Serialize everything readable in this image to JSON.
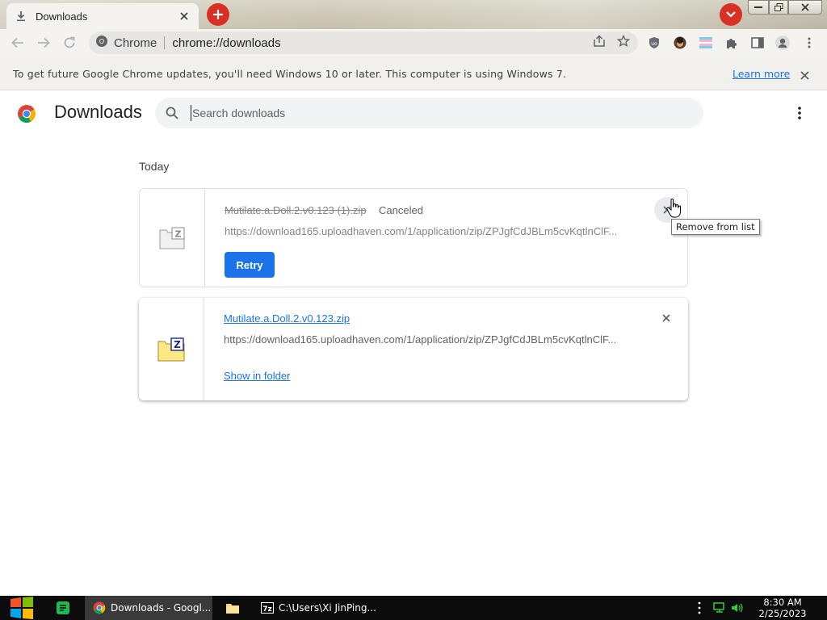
{
  "browser": {
    "tab": {
      "title": "Downloads",
      "icon": "download-icon"
    },
    "colors": {
      "accent_red": "#d93025",
      "link_blue": "#1a73e8"
    },
    "omnibox": {
      "site_label": "Chrome",
      "url": "chrome://downloads"
    }
  },
  "infobar": {
    "message": "To get future Google Chrome updates, you'll need Windows 10 or later. This computer is using Windows 7.",
    "link": "Learn more"
  },
  "page": {
    "title": "Downloads",
    "search_placeholder": "Search downloads",
    "section": "Today"
  },
  "downloads": [
    {
      "filename": "Mutilate.a.Doll.2.v0.123 (1).zip",
      "status": "Canceled",
      "url": "https://download165.uploadhaven.com/1/application/zip/ZPJgfCdJBLm5cvKqtlnClF...",
      "action": "Retry",
      "icon": "zip-file-icon-faded"
    },
    {
      "filename": "Mutilate.a.Doll.2.v0.123.zip",
      "status": "",
      "url": "https://download165.uploadhaven.com/1/application/zip/ZPJgfCdJBLm5cvKqtlnClF...",
      "action": "Show in folder",
      "icon": "zip-file-icon"
    }
  ],
  "tooltip": "Remove from list",
  "taskbar": {
    "items": [
      {
        "label": "Downloads - Googl..."
      },
      {
        "label": "C:\\Users\\Xi JinPing..."
      }
    ],
    "clock": {
      "time": "8:30 AM",
      "date": "2/25/2023"
    }
  }
}
